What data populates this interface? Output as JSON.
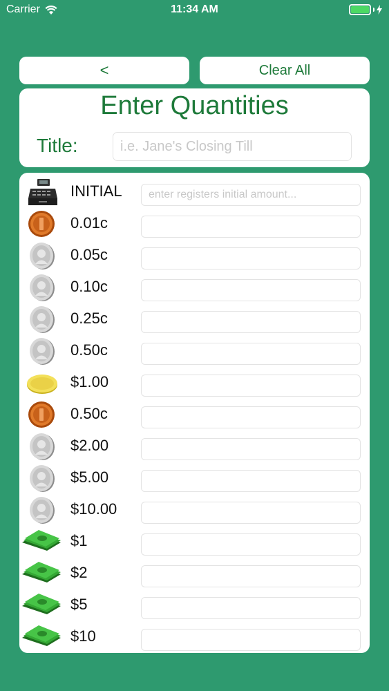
{
  "status_bar": {
    "carrier": "Carrier",
    "time": "11:34 AM"
  },
  "toolbar": {
    "back_label": "<",
    "clear_label": "Clear All"
  },
  "header": {
    "title": "Enter Quantities",
    "title_label": "Title:",
    "title_placeholder": "i.e. Jane's Closing Till"
  },
  "rows": [
    {
      "label": "INITIAL",
      "icon": "cash-register-icon",
      "placeholder": "enter registers initial amount..."
    },
    {
      "label": "0.01c",
      "icon": "copper-coin-icon",
      "placeholder": ""
    },
    {
      "label": "0.05c",
      "icon": "silver-coin-icon",
      "placeholder": ""
    },
    {
      "label": "0.10c",
      "icon": "silver-coin-icon",
      "placeholder": ""
    },
    {
      "label": "0.25c",
      "icon": "silver-coin-icon",
      "placeholder": ""
    },
    {
      "label": "0.50c",
      "icon": "silver-coin-icon",
      "placeholder": ""
    },
    {
      "label": "$1.00",
      "icon": "gold-coin-icon",
      "placeholder": ""
    },
    {
      "label": "0.50c",
      "icon": "copper-coin-icon",
      "placeholder": ""
    },
    {
      "label": "$2.00",
      "icon": "silver-coin-icon",
      "placeholder": ""
    },
    {
      "label": "$5.00",
      "icon": "silver-coin-icon",
      "placeholder": ""
    },
    {
      "label": "$10.00",
      "icon": "silver-coin-icon",
      "placeholder": ""
    },
    {
      "label": "$1",
      "icon": "banknote-icon",
      "placeholder": ""
    },
    {
      "label": "$2",
      "icon": "banknote-icon",
      "placeholder": ""
    },
    {
      "label": "$5",
      "icon": "banknote-icon",
      "placeholder": ""
    },
    {
      "label": "$10",
      "icon": "banknote-icon",
      "placeholder": ""
    }
  ],
  "colors": {
    "background": "#2e9a6f",
    "accent": "#1e7a3a",
    "battery": "#4cd964"
  }
}
